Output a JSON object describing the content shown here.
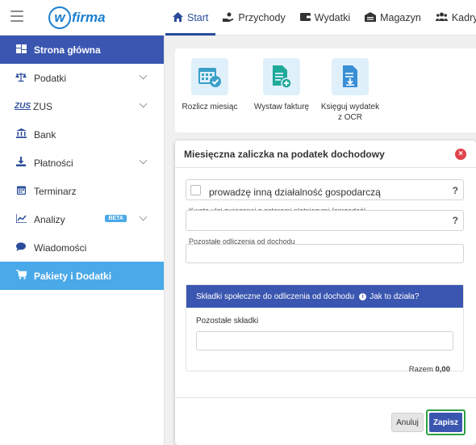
{
  "topbar": {
    "logo_text": "firma",
    "logo_mark": "w",
    "nav": [
      {
        "label": "Start",
        "icon": "home-icon",
        "active": true
      },
      {
        "label": "Przychody",
        "icon": "hand-coin-icon",
        "active": false
      },
      {
        "label": "Wydatki",
        "icon": "wallet-icon",
        "active": false
      },
      {
        "label": "Magazyn",
        "icon": "warehouse-icon",
        "active": false
      },
      {
        "label": "Kadry",
        "icon": "users-icon",
        "active": false
      }
    ]
  },
  "sidebar": {
    "items": [
      {
        "label": "Strona główna",
        "icon": "dashboard-icon"
      },
      {
        "label": "Podatki",
        "icon": "scales-icon"
      },
      {
        "label": "ZUS",
        "icon": "zus-logo-icon",
        "icon_text": "ZUS"
      },
      {
        "label": "Bank",
        "icon": "bank-icon"
      },
      {
        "label": "Płatności",
        "icon": "download-icon"
      },
      {
        "label": "Terminarz",
        "icon": "calendar-icon"
      },
      {
        "label": "Analizy",
        "icon": "chart-icon",
        "badge": "BETA"
      },
      {
        "label": "Wiadomości",
        "icon": "chat-icon"
      },
      {
        "label": "Pakiety i Dodatki",
        "icon": "cart-icon"
      }
    ]
  },
  "quick_actions": [
    {
      "label": "Rozlicz miesiąc",
      "icon": "calendar-check-icon"
    },
    {
      "label": "Wystaw fakturę",
      "icon": "invoice-add-icon"
    },
    {
      "label": "Księguj wydatek",
      "label2": "z OCR",
      "icon": "document-download-icon"
    }
  ],
  "modal": {
    "title": "Miesięczna zaliczka na podatek dochodowy",
    "checkbox_label": "prowadzę inną działalność gospodarczą",
    "help_mark": "?",
    "ulga_label": "Kwota ulgi związanej z zatorami płatniczymi (sprzedaż)",
    "pozostale_label": "Pozostałe odliczenia od dochodu",
    "subpanel": {
      "title": "Składki społeczne do odliczenia od dochodu",
      "help_link": "Jak to działa?",
      "field_label": "Pozostałe składki",
      "total_label": "Razem",
      "total_value": "0,00"
    },
    "cancel_label": "Anuluj",
    "save_label": "Zapisz",
    "close_glyph": "×"
  },
  "colors": {
    "accent": "#3a56b0",
    "sidebar_selected": "#4aa9e9",
    "save_outline": "#2ea043",
    "close": "#e0434b"
  }
}
